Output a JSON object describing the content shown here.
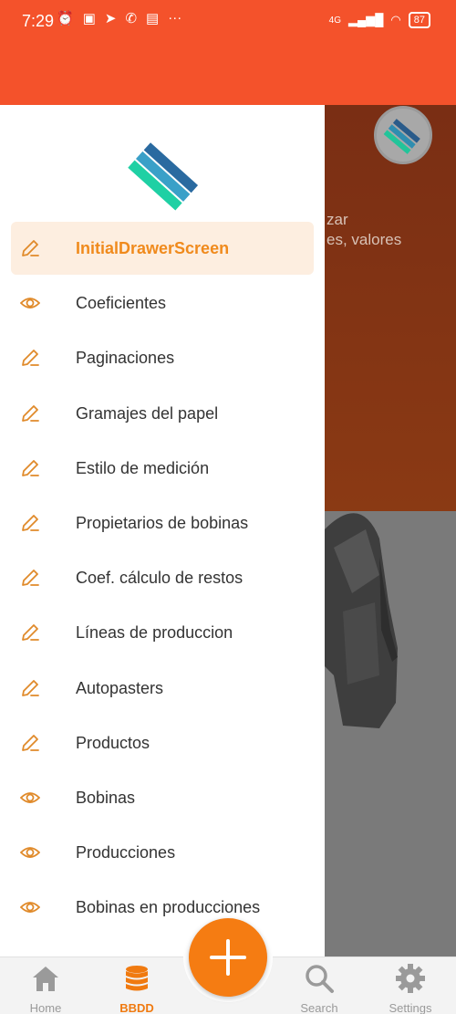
{
  "status_bar": {
    "time": "7:29",
    "network": "4G",
    "battery": "87"
  },
  "background": {
    "text_line1": "zar",
    "text_line2": "es, valores"
  },
  "drawer": {
    "items": [
      {
        "label": "InitialDrawerScreen",
        "icon": "pencil-icon",
        "active": true
      },
      {
        "label": "Coeficientes",
        "icon": "eye-icon",
        "active": false
      },
      {
        "label": "Paginaciones",
        "icon": "pencil-icon",
        "active": false
      },
      {
        "label": "Gramajes del papel",
        "icon": "pencil-icon",
        "active": false
      },
      {
        "label": "Estilo de medición",
        "icon": "pencil-icon",
        "active": false
      },
      {
        "label": "Propietarios de bobinas",
        "icon": "pencil-icon",
        "active": false
      },
      {
        "label": "Coef. cálculo de restos",
        "icon": "pencil-icon",
        "active": false
      },
      {
        "label": "Líneas de produccion",
        "icon": "pencil-icon",
        "active": false
      },
      {
        "label": "Autopasters",
        "icon": "pencil-icon",
        "active": false
      },
      {
        "label": "Productos",
        "icon": "pencil-icon",
        "active": false
      },
      {
        "label": "Bobinas",
        "icon": "eye-icon",
        "active": false
      },
      {
        "label": "Producciones",
        "icon": "eye-icon",
        "active": false
      },
      {
        "label": "Bobinas en producciones",
        "icon": "eye-icon",
        "active": false
      }
    ]
  },
  "bottom_nav": {
    "tabs": [
      {
        "label": "Home",
        "icon": "home-icon",
        "active": false
      },
      {
        "label": "BBDD",
        "icon": "database-icon",
        "active": true
      },
      {
        "label": "Search",
        "icon": "search-icon",
        "active": false
      },
      {
        "label": "Settings",
        "icon": "gear-icon",
        "active": false
      }
    ],
    "fab_icon": "plus-icon"
  },
  "colors": {
    "app_bar": "#f4522b",
    "accent": "#f08a1c",
    "active_item_bg": "#fdeee0"
  }
}
